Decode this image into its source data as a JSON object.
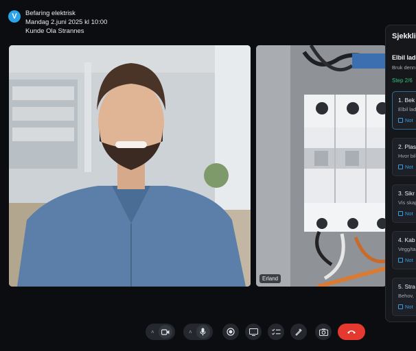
{
  "app": {
    "logo_letter": "V",
    "brand_color": "#2aa3e8"
  },
  "meeting": {
    "title": "Befaring elektrisk",
    "datetime": "Mandag 2.juni 2025 kl 10:00",
    "customer": "Kunde Ola Strannes"
  },
  "participants": [
    {
      "name": "",
      "type": "video"
    },
    {
      "name": "Erland",
      "type": "video"
    }
  ],
  "sidebar": {
    "title": "Sjekklis",
    "section_title": "Elbil lade",
    "section_desc": "Bruk denn",
    "step_label": "Step 2/6",
    "step_color": "#36c07a",
    "items": [
      {
        "title": "1. Bek",
        "desc": "Elbil lad",
        "note": "Not",
        "active": true
      },
      {
        "title": "2. Plas",
        "desc": "Hvor bil",
        "note": "Not",
        "active": false
      },
      {
        "title": "3. Sikr",
        "desc": "Vis skap",
        "note": "Not",
        "active": false
      },
      {
        "title": "4. Kab",
        "desc": "Vegg/ta",
        "note": "Not",
        "active": false
      },
      {
        "title": "5. Stra",
        "desc": "Behov,",
        "note": "Not",
        "active": false
      }
    ]
  },
  "controls": {
    "camera": {
      "icon": "camera-icon",
      "chevron": "˄"
    },
    "microphone": {
      "icon": "microphone-icon",
      "chevron": "˄"
    },
    "buttons": [
      "record-icon",
      "screen-share-icon",
      "checklist-icon",
      "annotate-icon",
      "snapshot-icon"
    ],
    "end_call": {
      "icon": "phone-hangup-icon",
      "color": "#e5392f"
    }
  }
}
